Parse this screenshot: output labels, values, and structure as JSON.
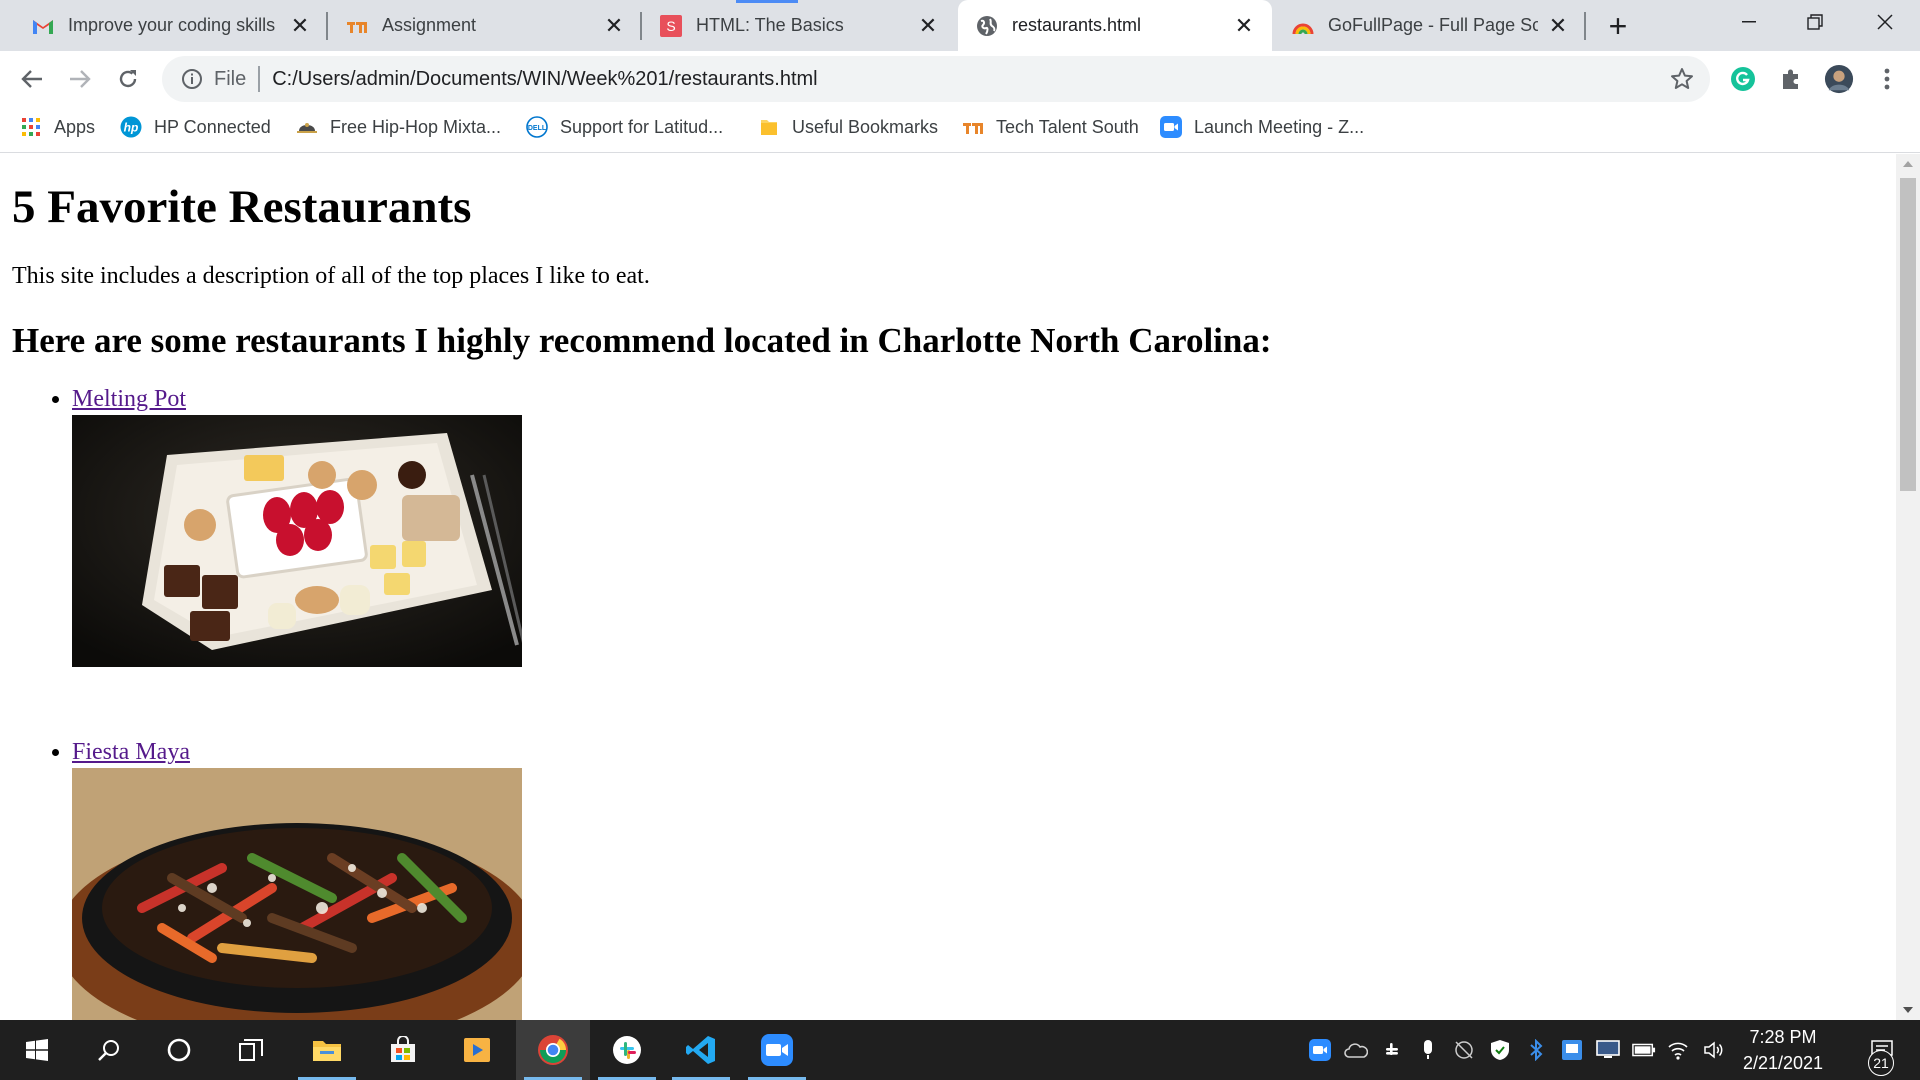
{
  "tabs": [
    {
      "title": "Improve your coding skills w",
      "icon": "gmail-icon",
      "active": false
    },
    {
      "title": "Assignment",
      "icon": "tts-icon",
      "active": false
    },
    {
      "title": "HTML: The Basics",
      "icon": "s-icon",
      "active": false
    },
    {
      "title": "restaurants.html",
      "icon": "globe-icon",
      "active": true
    },
    {
      "title": "GoFullPage - Full Page Scre",
      "icon": "gofullpage-icon",
      "active": false
    }
  ],
  "window": {
    "new_tab": "+",
    "minimize": "—",
    "restore": "❐",
    "close": "✕"
  },
  "omnibox": {
    "scheme": "File",
    "url": "C:/Users/admin/Documents/WIN/Week%201/restaurants.html"
  },
  "extensions": [
    {
      "name": "grammarly-icon",
      "color": "#15c39a"
    },
    {
      "name": "puzzle-icon",
      "color": "#5f6368"
    },
    {
      "name": "avatar",
      "color": "#3b4a5a"
    }
  ],
  "bookmarks": [
    {
      "label": "Apps",
      "icon": "apps-grid-icon"
    },
    {
      "label": "HP Connected",
      "icon": "hp-icon"
    },
    {
      "label": "Free Hip-Hop Mixta...",
      "icon": "mixtape-icon"
    },
    {
      "label": "Support for Latitud...",
      "icon": "dell-icon"
    },
    {
      "label": "Useful Bookmarks",
      "icon": "folder-icon"
    },
    {
      "label": "Tech Talent South",
      "icon": "tts-icon"
    },
    {
      "label": "Launch Meeting - Z...",
      "icon": "zoom-icon"
    }
  ],
  "page": {
    "heading": "5 Favorite Restaurants",
    "intro": "This site includes a description of all of the top places I like to eat.",
    "subheading": "Here are some restaurants I highly recommend located in Charlotte North Carolina:",
    "restaurants": [
      {
        "name": "Melting Pot",
        "image": "dessert-fondue-plate"
      },
      {
        "name": "Fiesta Maya",
        "image": "sizzling-fajitas"
      }
    ]
  },
  "taskbar": {
    "apps": [
      "windows-start-icon",
      "search-icon",
      "cortana-icon",
      "task-view-icon",
      "file-explorer-icon",
      "store-icon",
      "media-player-icon",
      "chrome-icon",
      "slack-icon",
      "vscode-icon",
      "zoom-icon"
    ],
    "time": "7:28 PM",
    "date": "2/21/2021",
    "notifications": "21"
  },
  "colors": {
    "tabstrip": "#dee1e6",
    "link_visited": "#551a8b",
    "taskbar": "#1f1f1f",
    "accent": "#4c8bf5"
  }
}
